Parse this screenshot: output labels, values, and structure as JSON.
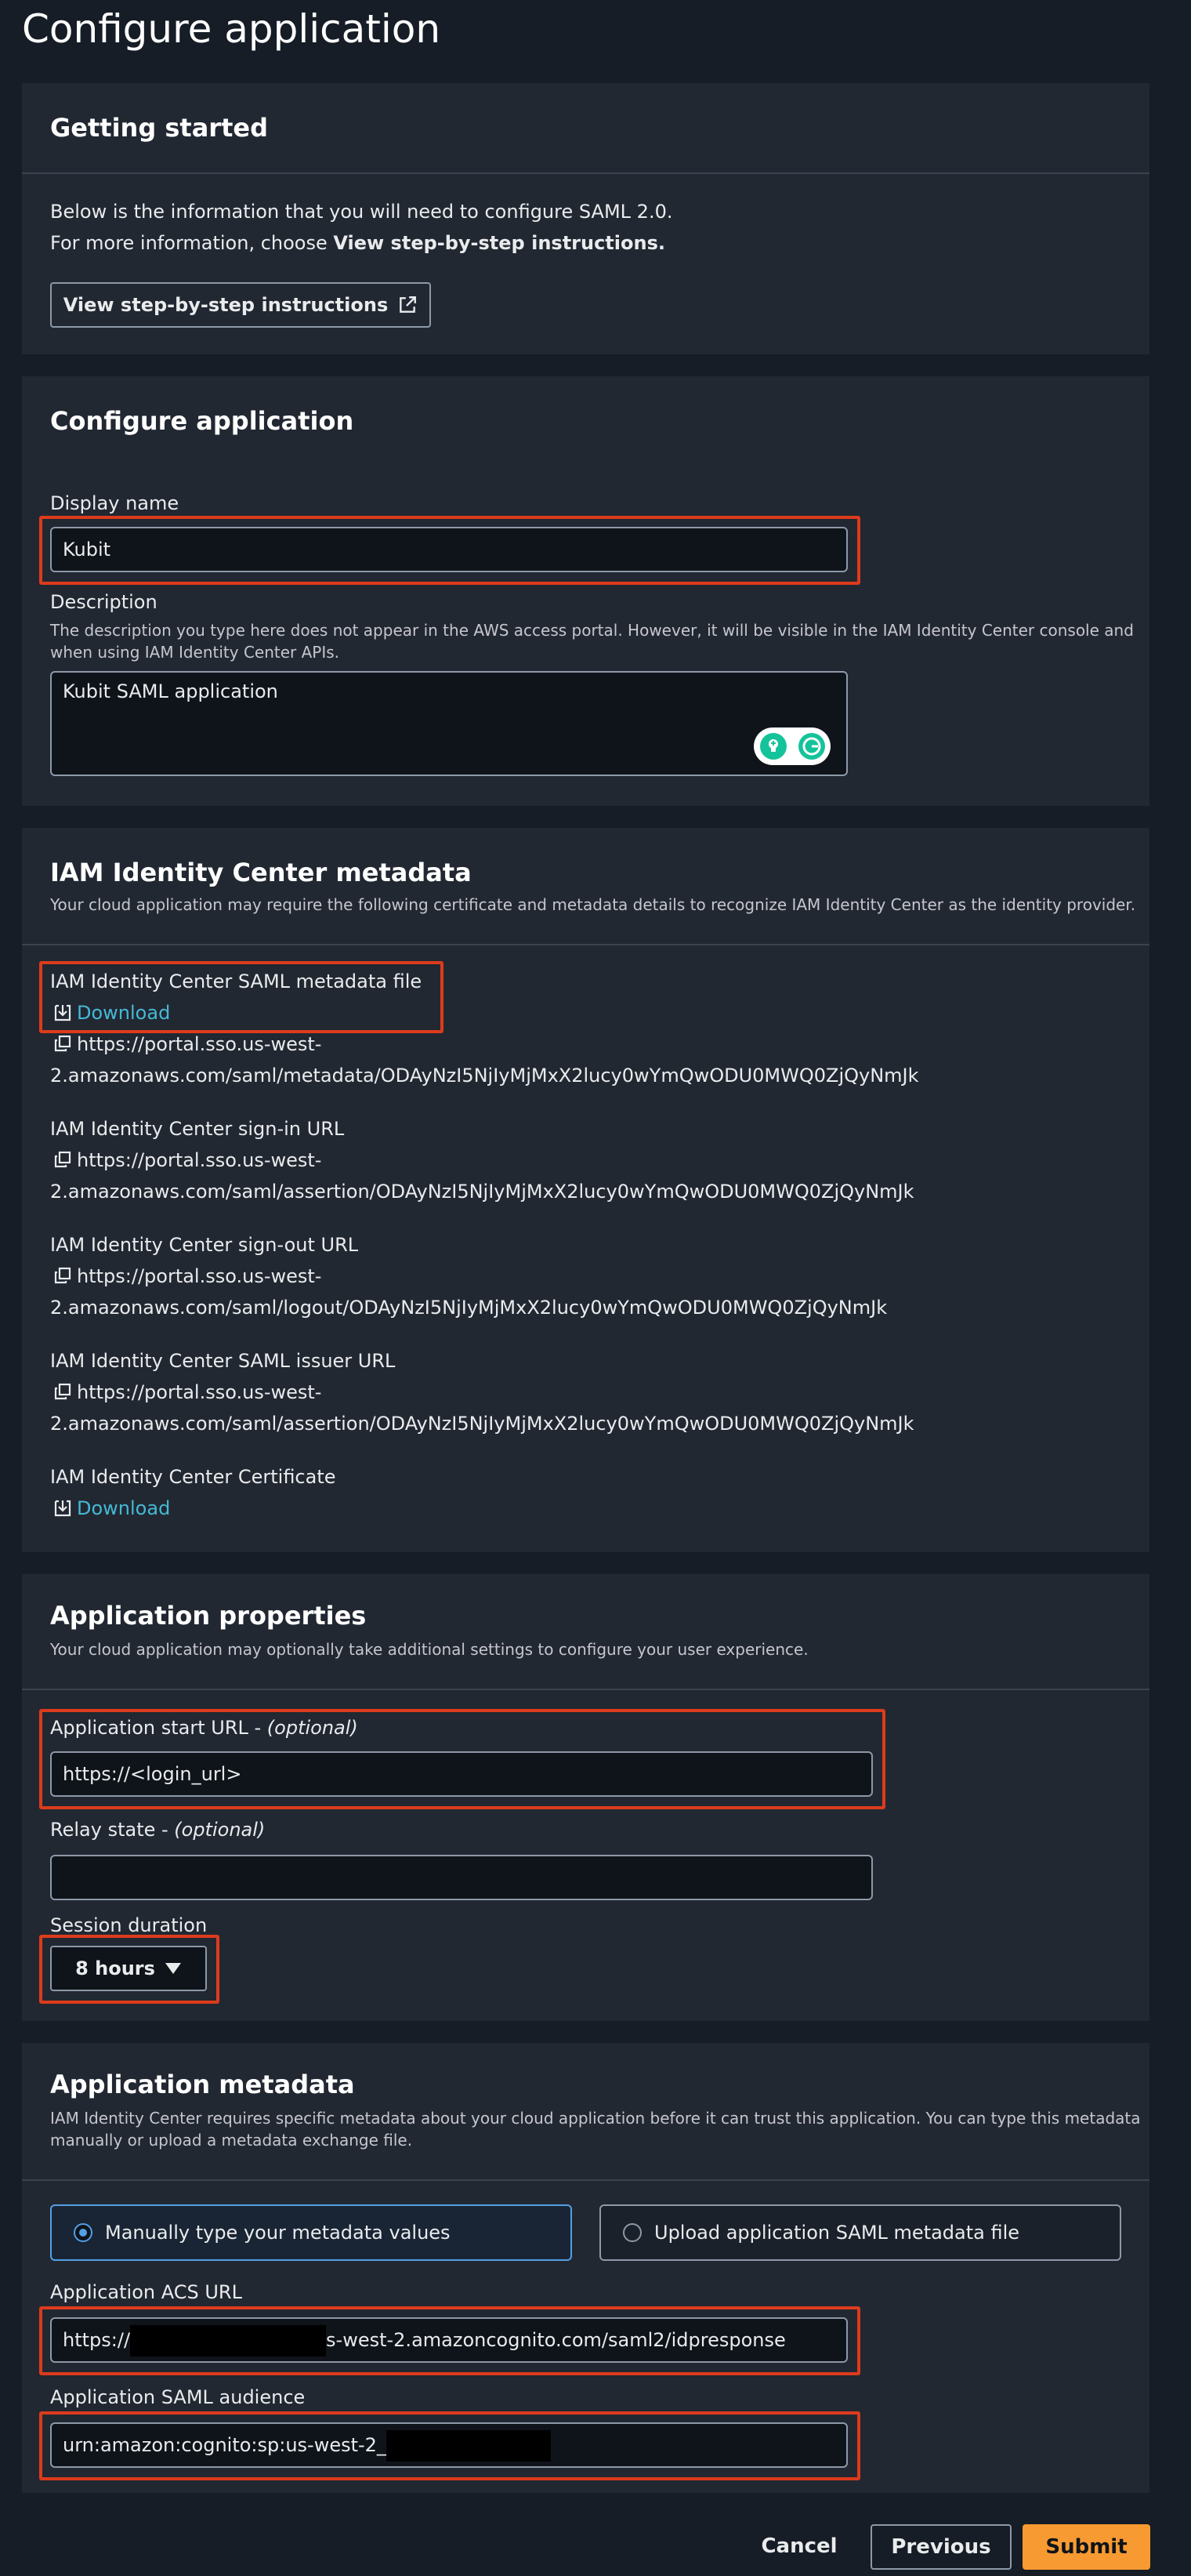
{
  "page": {
    "title": "Configure application"
  },
  "getting_started": {
    "heading": "Getting started",
    "line1": "Below is the information that you will need to configure SAML 2.0.",
    "line2_prefix": "For more information, choose ",
    "line2_bold": "View step-by-step instructions.",
    "button_label": "View step-by-step instructions",
    "button_icon": "external-link-icon"
  },
  "configure_application": {
    "heading": "Configure application",
    "display_name_label": "Display name",
    "display_name_value": "Kubit",
    "description_label": "Description",
    "description_help_line1": "The description you type here does not appear in the AWS access portal. However, it will be visible in the IAM Identity Center console and",
    "description_help_line2": "when using IAM Identity Center APIs.",
    "description_value": "Kubit SAML application",
    "grammarly_icons": [
      "lightbulb-icon",
      "grammarly-icon"
    ]
  },
  "idc_metadata": {
    "heading": "IAM Identity Center metadata",
    "subtitle": "Your cloud application may require the following certificate and metadata details to recognize IAM Identity Center as the identity provider.",
    "saml_file_label": "IAM Identity Center SAML metadata file",
    "download_label": "Download",
    "metadata_url_line1": "https://portal.sso.us-west-",
    "metadata_url_line2": "2.amazonaws.com/saml/metadata/ODAyNzI5NjIyMjMxX2lucy0wYmQwODU0MWQ0ZjQyNmJk",
    "signin_label": "IAM Identity Center sign-in URL",
    "signin_url_line1": "https://portal.sso.us-west-",
    "signin_url_line2": "2.amazonaws.com/saml/assertion/ODAyNzI5NjIyMjMxX2lucy0wYmQwODU0MWQ0ZjQyNmJk",
    "signout_label": "IAM Identity Center sign-out URL",
    "signout_url_line1": "https://portal.sso.us-west-",
    "signout_url_line2": "2.amazonaws.com/saml/logout/ODAyNzI5NjIyMjMxX2lucy0wYmQwODU0MWQ0ZjQyNmJk",
    "issuer_label": "IAM Identity Center SAML issuer URL",
    "issuer_url_line1": "https://portal.sso.us-west-",
    "issuer_url_line2": "2.amazonaws.com/saml/assertion/ODAyNzI5NjIyMjMxX2lucy0wYmQwODU0MWQ0ZjQyNmJk",
    "certificate_label": "IAM Identity Center Certificate",
    "certificate_download_label": "Download"
  },
  "app_properties": {
    "heading": "Application properties",
    "subtitle": "Your cloud application may optionally take additional settings to configure your user experience.",
    "start_url_label": "Application start URL - ",
    "start_url_optional": "(optional)",
    "start_url_value": "https://<login_url>",
    "relay_state_label": "Relay state - ",
    "relay_state_optional": "(optional)",
    "relay_state_value": "",
    "session_duration_label": "Session duration",
    "session_duration_value": "8 hours"
  },
  "app_metadata": {
    "heading": "Application metadata",
    "subtitle_line1": "IAM Identity Center requires specific metadata about your cloud application before it can trust this application. You can type this metadata",
    "subtitle_line2": "manually or upload a metadata exchange file.",
    "option_manual": "Manually type your metadata values",
    "option_upload": "Upload application SAML metadata file",
    "selected_option": "manual",
    "acs_label": "Application ACS URL",
    "acs_prefix": "https://",
    "acs_suffix": "s-west-2.amazoncognito.com/saml2/idpresponse",
    "audience_label": "Application SAML audience",
    "audience_value": "urn:amazon:cognito:sp:us-west-2_"
  },
  "footer": {
    "cancel_label": "Cancel",
    "previous_label": "Previous",
    "submit_label": "Submit"
  },
  "colors": {
    "background": "#161d26",
    "card": "#222832",
    "highlight": "#dd3b1c",
    "link": "#44b9d6",
    "primary_button": "#f89a32"
  }
}
